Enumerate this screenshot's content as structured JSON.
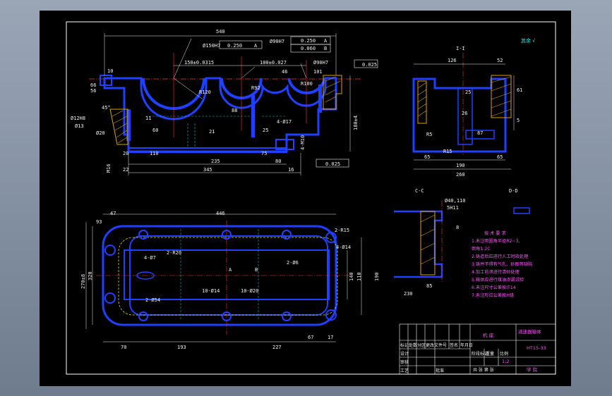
{
  "drawing": {
    "front_view": {
      "dims": {
        "overall_length": "540",
        "bore_left": "Ø150H7",
        "tol_left": "0.250",
        "datum_left": "A",
        "bore_right": "Ø90H7",
        "tol_right_a": "0.250",
        "datum_right_a": "A",
        "tol_right_b": "0.060",
        "datum_right_b": "B",
        "center_dist_1": "150±0.0315",
        "center_dist_2": "100±0.027",
        "bore_far_right": "Ø90H7",
        "flatness_top": "0.025",
        "d46": "46",
        "d101": "101",
        "d10": "10",
        "r120": "R120",
        "r100": "R100",
        "r92": "R92",
        "d56": "56",
        "d66": "66",
        "hole_1": "Ø12H8",
        "hole_1b": "Ø13",
        "hole_2": "Ø20",
        "angle": "45°",
        "d88": "88",
        "d60": "60",
        "bottom_110": "110",
        "bottom_235": "235",
        "bottom_345": "345",
        "bottom_20": "20",
        "bottom_22": "22",
        "bottom_75": "75",
        "bottom_80": "80",
        "bottom_16": "16",
        "height_180": "180±4",
        "holes_4": "4-Ø17",
        "flatness_bottom": "0.025",
        "d11": "11",
        "d21": "21",
        "d25": "25",
        "thread_left": "M16",
        "thread_right": "4-M10"
      }
    },
    "side_view": {
      "label": "I-I",
      "dims": {
        "w126": "126",
        "w52": "52",
        "d25": "25",
        "r5": "R5",
        "r15": "R15",
        "d65a": "65",
        "d65b": "65",
        "d87": "87",
        "d26": "26",
        "w190": "190",
        "w260": "260",
        "d61": "61",
        "d5": "5"
      }
    },
    "top_view": {
      "dims": {
        "d47": "47",
        "d446": "446",
        "d93": "93",
        "d270": "270±8",
        "d320": "320",
        "d140": "140",
        "d190": "190",
        "d110": "110",
        "d70": "70",
        "d193": "193",
        "d227": "227",
        "d67": "67",
        "d17": "17",
        "r15": "2-R15",
        "r20": "2-R20",
        "hole_a": "4-Ø14",
        "hole_b": "10-Ø14",
        "hole_c": "10-Ø20",
        "hole_d": "4-Ø7",
        "hole_e": "2-Ø54",
        "hole_f": "2-Ø6",
        "mark_a": "A",
        "mark_b": "B"
      }
    },
    "section_view": {
      "label": "C-C",
      "label_2": "D-D",
      "dims": {
        "d740": "Ø40,110",
        "d5h": "5H11",
        "d8": "8",
        "d85": "85",
        "d230": "230"
      }
    },
    "roughness_note": "其余",
    "tech_requirements": {
      "title": "技 术 要 求",
      "lines": [
        "1.未注明圆角半径R2~3,",
        "  倒角1.2C",
        "2.铸造后应进行人工时效处理",
        "3.铸件不得有气孔、砂眼等缺陷",
        "4.加工前须进行清砂处理",
        "5.箱体应进行煤油渗漏试验",
        "6.未注尺寸公差按IT14",
        "7.未注形位公差按H级"
      ]
    },
    "title_block": {
      "drawing_name": "减速器箱体",
      "material": "HT15-33",
      "scale_label": "比例",
      "scale": "1:2",
      "weight_label": "重量",
      "sheet": "共 张 第 张",
      "school": "机 座",
      "heads": [
        "标记",
        "处数",
        "分区",
        "更改文件号",
        "签名",
        "年月日"
      ],
      "roles": [
        "设计",
        "审核",
        "工艺",
        "批准"
      ],
      "stage": "阶段标记",
      "owner": "学 院"
    }
  }
}
